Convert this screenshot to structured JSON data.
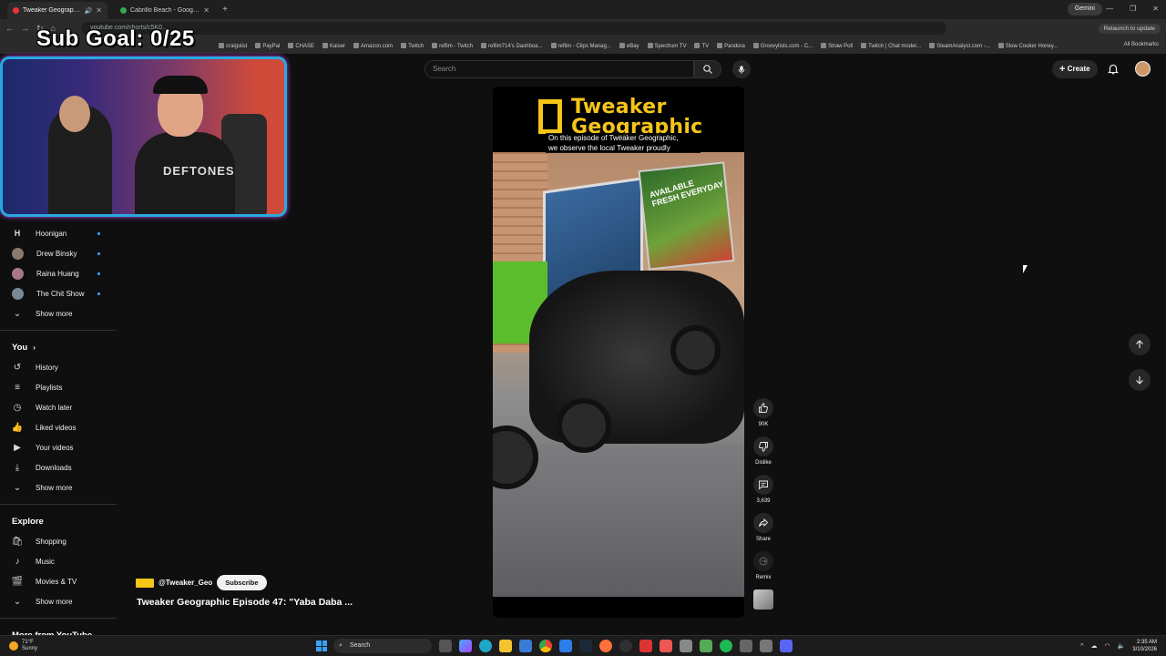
{
  "browser": {
    "tabs": [
      {
        "title": "Tweaker Geographic Episod",
        "active": true,
        "audio": "🔊"
      },
      {
        "title": "Cabrillo Beach - Google Maps",
        "active": false
      }
    ],
    "gemini_label": "Gemini",
    "address": "youtube.com/shorts/c5K0...",
    "relaunch_label": "Relaunch to update",
    "bookmarks": [
      "craigslist",
      "PayPal",
      "CHASE",
      "Kaiser",
      "Amazon.com",
      "Twitch",
      "reflim - Twitch",
      "reflim714's Dashboa...",
      "reflim - Clips Manag...",
      "eBay",
      "Spectrum TV",
      "TV",
      "Pandora",
      "Groovylists.com - C...",
      "Straw Poll",
      "Twitch | Chat moder...",
      "SteamAnalyst.com -...",
      "Slow Cooker Honey..."
    ],
    "all_bookmarks": "All Bookmarks"
  },
  "overlay": {
    "sub_goal": "Sub Goal: 0/25",
    "shirt_text": "DEFTONES"
  },
  "youtube": {
    "search_placeholder": "Search",
    "create_label": "Create",
    "subscriptions": [
      {
        "name": "Hoonigan",
        "icon": "H"
      },
      {
        "name": "Drew Binsky"
      },
      {
        "name": "Raina Huang"
      },
      {
        "name": "The Chit Show"
      }
    ],
    "show_more": "Show more",
    "you_header": "You",
    "you_items": [
      {
        "label": "History",
        "icon": "history-icon",
        "glyph": "↺"
      },
      {
        "label": "Playlists",
        "icon": "playlist-icon",
        "glyph": "≡"
      },
      {
        "label": "Watch later",
        "icon": "clock-icon",
        "glyph": "◷"
      },
      {
        "label": "Liked videos",
        "icon": "thumbs-up-icon",
        "glyph": "👍"
      },
      {
        "label": "Your videos",
        "icon": "video-icon",
        "glyph": "▶"
      },
      {
        "label": "Downloads",
        "icon": "download-icon",
        "glyph": "⤓"
      }
    ],
    "explore_header": "Explore",
    "explore_items": [
      {
        "label": "Shopping",
        "icon": "shopping-icon",
        "glyph": "🛍"
      },
      {
        "label": "Music",
        "icon": "music-icon",
        "glyph": "♪"
      },
      {
        "label": "Movies & TV",
        "icon": "movies-icon",
        "glyph": "🎬"
      }
    ],
    "more_from_youtube": "More from YouTube",
    "short": {
      "brand_title": "Tweaker Geographic",
      "caption_line1": "On this episode of Tweaker Geographic,",
      "caption_line2": "we observe the local Tweaker proudly",
      "poster_text": "AVAILABLE FRESH EVERYDAY",
      "channel_handle": "@Tweaker_Geo",
      "subscribe_label": "Subscribe",
      "video_title": "Tweaker Geographic Episode 47: \"Yaba Daba ..."
    },
    "actions": {
      "likes": "90K",
      "dislike": "Dislike",
      "comments": "3,639",
      "share": "Share",
      "remix": "Remix"
    }
  },
  "taskbar": {
    "temperature": "71°F",
    "weather": "Sunny",
    "search_label": "Search",
    "time": "2:35 AM",
    "date": "3/10/2026"
  },
  "colors": {
    "accent_yellow": "#f5c518",
    "youtube_bg": "#0f0f0f",
    "new_dot": "#3ea6ff"
  }
}
